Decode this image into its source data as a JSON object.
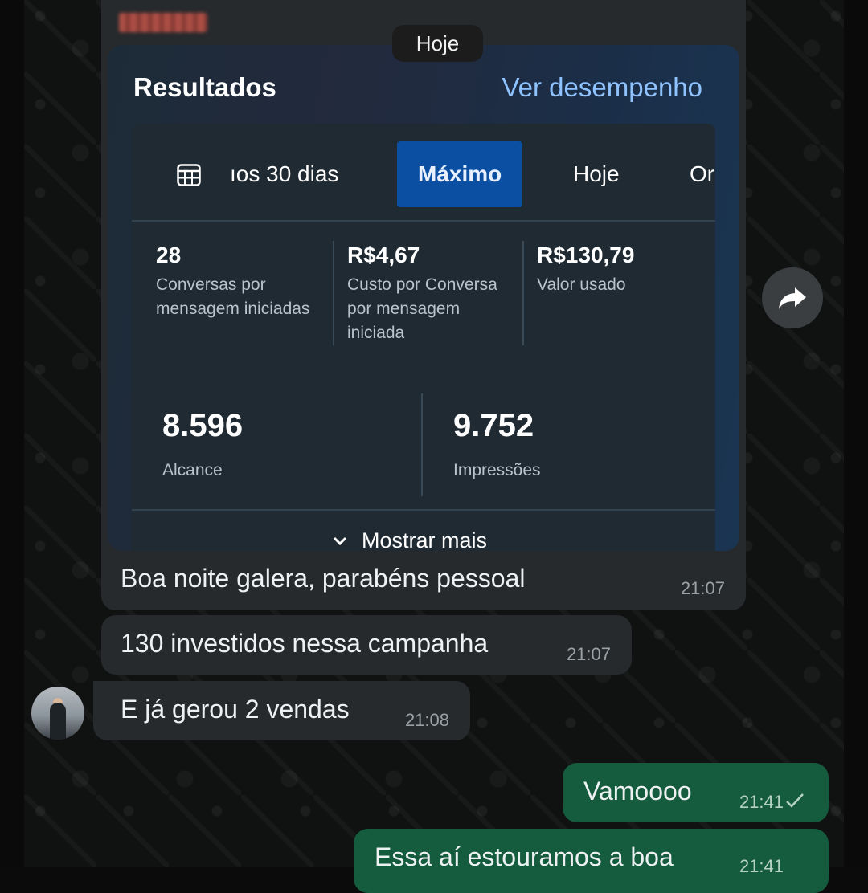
{
  "date_chip": "Hoje",
  "screenshot": {
    "title": "Resultados",
    "link": "Ver desempenho",
    "tabs": [
      "ıos 30 dias",
      "Máximo",
      "Hoje",
      "Or"
    ],
    "active_tab": "Máximo",
    "metrics": [
      {
        "value": "28",
        "label": "Conversas por mensagem iniciadas"
      },
      {
        "value": "R$4,67",
        "label": "Custo por Conversa por mensagem iniciada"
      },
      {
        "value": "R$130,79",
        "label": "Valor usado"
      }
    ],
    "big_metrics": [
      {
        "value": "8.596",
        "label": "Alcance"
      },
      {
        "value": "9.752",
        "label": "Impressões"
      }
    ],
    "show_more": "Mostrar mais",
    "accent_color": "#0b4fa3",
    "link_color": "#8ec3ff"
  },
  "messages": [
    {
      "text": "Boa noite galera, parabéns pessoal",
      "time": "21:07",
      "direction": "in"
    },
    {
      "text": "130 investidos nessa campanha",
      "time": "21:07",
      "direction": "in"
    },
    {
      "text": "E já gerou 2 vendas",
      "time": "21:08",
      "direction": "in"
    },
    {
      "text": "Vamoooo",
      "time": "21:41",
      "direction": "out"
    },
    {
      "text": "Essa aí estouramos a boa",
      "time": "21:41",
      "direction": "out"
    }
  ],
  "icons": [
    "calendar-icon",
    "chevron-down-icon",
    "forward-icon",
    "check-icon",
    "avatar"
  ],
  "colors": {
    "incoming_bubble": "#262a2d",
    "outgoing_bubble": "#155c3e"
  }
}
